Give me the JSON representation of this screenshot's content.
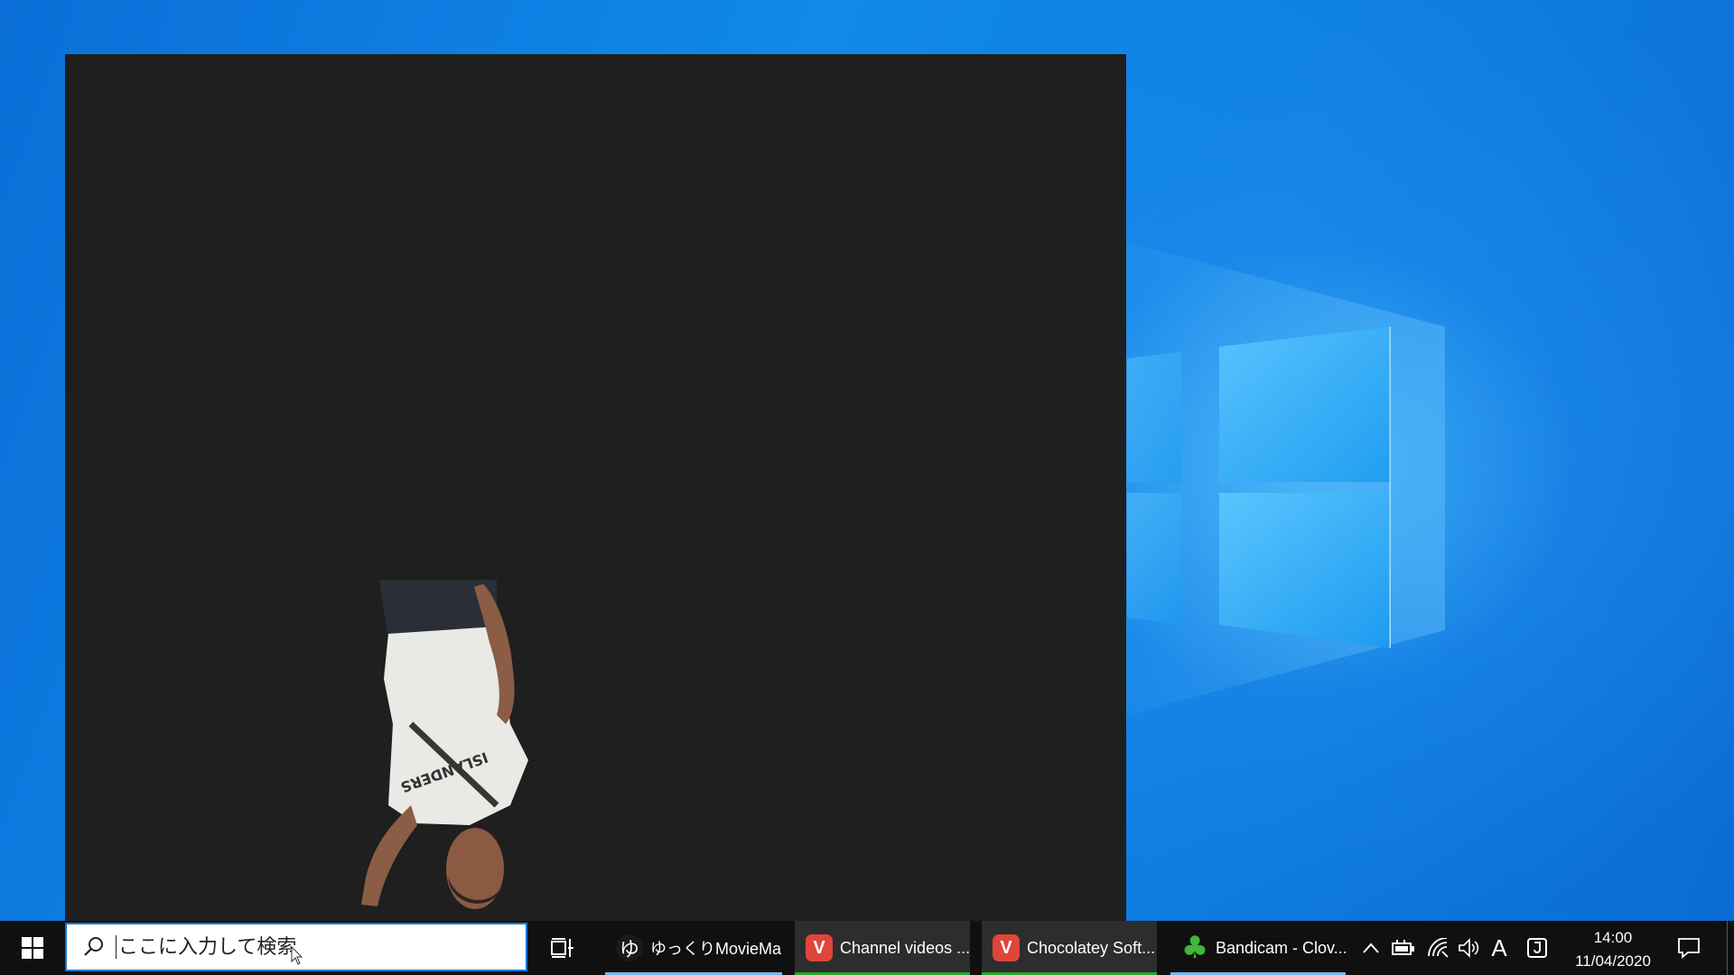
{
  "taskbar": {
    "search_placeholder": "ここに入力して検索",
    "apps": [
      {
        "label": "ゆっくりMovieMa...",
        "icon": "yukkuri-moviemaker-icon",
        "glyph": "ゆ",
        "underline": "#76b9ed"
      },
      {
        "label": "Channel videos ...",
        "icon": "vivaldi-icon",
        "glyph": "V",
        "underline": "#2aa52a"
      },
      {
        "label": "Chocolatey Soft...",
        "icon": "vivaldi-icon",
        "glyph": "V",
        "underline": "#2aa52a"
      },
      {
        "label": "Bandicam - Clov...",
        "icon": "clover-icon",
        "glyph": "♣",
        "underline": "#76b9ed"
      }
    ],
    "tray": {
      "ime_label": "A",
      "time": "14:00",
      "date": "11/04/2020"
    }
  },
  "colors": {
    "desktop_blue": "#0f80e3",
    "window_bg": "#1f1f1f",
    "taskbar_bg": "#101010",
    "vivaldi_red": "#e0453a"
  }
}
